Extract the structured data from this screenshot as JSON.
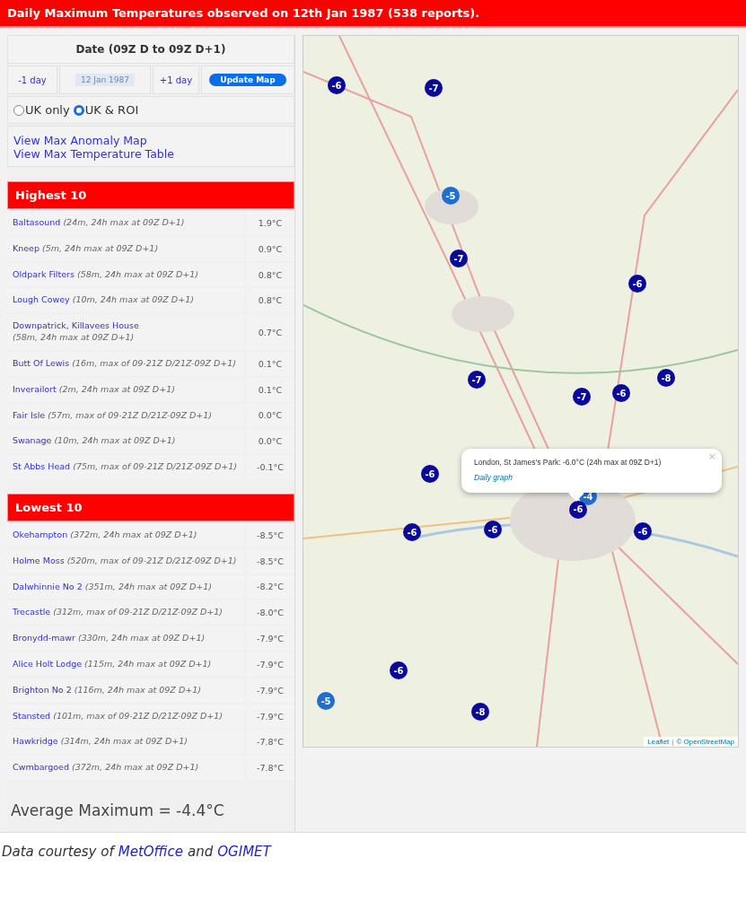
{
  "title": "Daily Maximum Temperatures observed on 12th Jan 1987 (538 reports).",
  "controls": {
    "heading": "Date (09Z D to 09Z D+1)",
    "prev": "-1 day",
    "date": "12 Jan 1987",
    "next": "+1 day",
    "update": "Update Map",
    "regions": [
      {
        "label": "UK only",
        "selected": false
      },
      {
        "label": "UK & ROI",
        "selected": true
      }
    ],
    "links": [
      "View Max Anomaly Map",
      "View Max Temperature Table"
    ]
  },
  "tables": [
    {
      "heading": "Highest 10",
      "rows": [
        {
          "station": "Baltasound",
          "detail": "(24m, 24h max at 09Z D+1)",
          "temp": "1.9°C"
        },
        {
          "station": "Kneep",
          "detail": "(5m, 24h max at 09Z D+1)",
          "temp": "0.9°C"
        },
        {
          "station": "Oldpark Filters",
          "detail": "(58m, 24h max at 09Z D+1)",
          "temp": "0.8°C"
        },
        {
          "station": "Lough Cowey",
          "detail": "(10m, 24h max at 09Z D+1)",
          "temp": "0.8°C"
        },
        {
          "station": "Downpatrick, Killavees House",
          "detail": "(58m, 24h max at 09Z D+1)",
          "temp": "0.7°C"
        },
        {
          "station": "Butt Of Lewis",
          "detail": "(16m, max of 09-21Z D/21Z-09Z D+1)",
          "temp": "0.1°C"
        },
        {
          "station": "Inverailort",
          "detail": "(2m, 24h max at 09Z D+1)",
          "temp": "0.1°C"
        },
        {
          "station": "Fair Isle",
          "detail": "(57m, max of 09-21Z D/21Z-09Z D+1)",
          "temp": "0.0°C"
        },
        {
          "station": "Swanage",
          "detail": "(10m, 24h max at 09Z D+1)",
          "temp": "0.0°C"
        },
        {
          "station": "St Abbs Head",
          "detail": "(75m, max of 09-21Z D/21Z-09Z D+1)",
          "temp": "-0.1°C"
        }
      ]
    },
    {
      "heading": "Lowest 10",
      "rows": [
        {
          "station": "Okehampton",
          "detail": "(372m, 24h max at 09Z D+1)",
          "temp": "-8.5°C"
        },
        {
          "station": "Holme Moss",
          "detail": "(520m, max of 09-21Z D/21Z-09Z D+1)",
          "temp": "-8.5°C"
        },
        {
          "station": "Dalwhinnie No 2",
          "detail": "(351m, 24h max at 09Z D+1)",
          "temp": "-8.2°C"
        },
        {
          "station": "Trecastle",
          "detail": "(312m, max of 09-21Z D/21Z-09Z D+1)",
          "temp": "-8.0°C"
        },
        {
          "station": "Bronydd-mawr",
          "detail": "(330m, 24h max at 09Z D+1)",
          "temp": "-7.9°C"
        },
        {
          "station": "Alice Holt Lodge",
          "detail": "(115m, 24h max at 09Z D+1)",
          "temp": "-7.9°C"
        },
        {
          "station": "Brighton No 2",
          "detail": "(116m, 24h max at 09Z D+1)",
          "temp": "-7.9°C"
        },
        {
          "station": "Stansted",
          "detail": "(101m, max of 09-21Z D/21Z-09Z D+1)",
          "temp": "-7.9°C"
        },
        {
          "station": "Hawkridge",
          "detail": "(314m, 24h max at 09Z D+1)",
          "temp": "-7.8°C"
        },
        {
          "station": "Cwmbargoed",
          "detail": "(372m, 24h max at 09Z D+1)",
          "temp": "-7.8°C"
        }
      ]
    }
  ],
  "average": "Average Maximum = -4.4°C",
  "map": {
    "markers": [
      {
        "label": "-6",
        "color": "#0a0a9a"
      },
      {
        "label": "-7",
        "color": "#0a0a9a"
      },
      {
        "label": "-5",
        "color": "#1f6fd0"
      },
      {
        "label": "-7",
        "color": "#0a0a9a"
      },
      {
        "label": "-6",
        "color": "#0a0a9a"
      },
      {
        "label": "-7",
        "color": "#0a0a9a"
      },
      {
        "label": "-8",
        "color": "#0a0a9a"
      },
      {
        "label": "-7",
        "color": "#0a0a9a"
      },
      {
        "label": "-6",
        "color": "#0a0a9a"
      },
      {
        "label": "-6",
        "color": "#0a0a9a"
      },
      {
        "label": "-4",
        "color": "#1f6fd0"
      },
      {
        "label": "-6",
        "color": "#0a0a9a"
      },
      {
        "label": "-6",
        "color": "#0a0a9a"
      },
      {
        "label": "-6",
        "color": "#0a0a9a"
      },
      {
        "label": "-6",
        "color": "#0a0a9a"
      },
      {
        "label": "-6",
        "color": "#0a0a9a"
      },
      {
        "label": "-5",
        "color": "#1f6fd0"
      },
      {
        "label": "-8",
        "color": "#0a0a9a"
      }
    ],
    "popup": {
      "text": "London, St James's Park: -6.0°C (24h max at 09Z D+1)",
      "link": "Daily graph",
      "close": "×"
    },
    "attribution": [
      {
        "text": "Leaflet",
        "kind": "link"
      },
      {
        "text": "|",
        "kind": "sep"
      },
      {
        "text": "© OpenStreetMap",
        "kind": "link"
      }
    ]
  },
  "footer": {
    "prefix": "Data courtesy of",
    "first": "MetOffice",
    "middle": "and",
    "second": "OGIMET"
  }
}
